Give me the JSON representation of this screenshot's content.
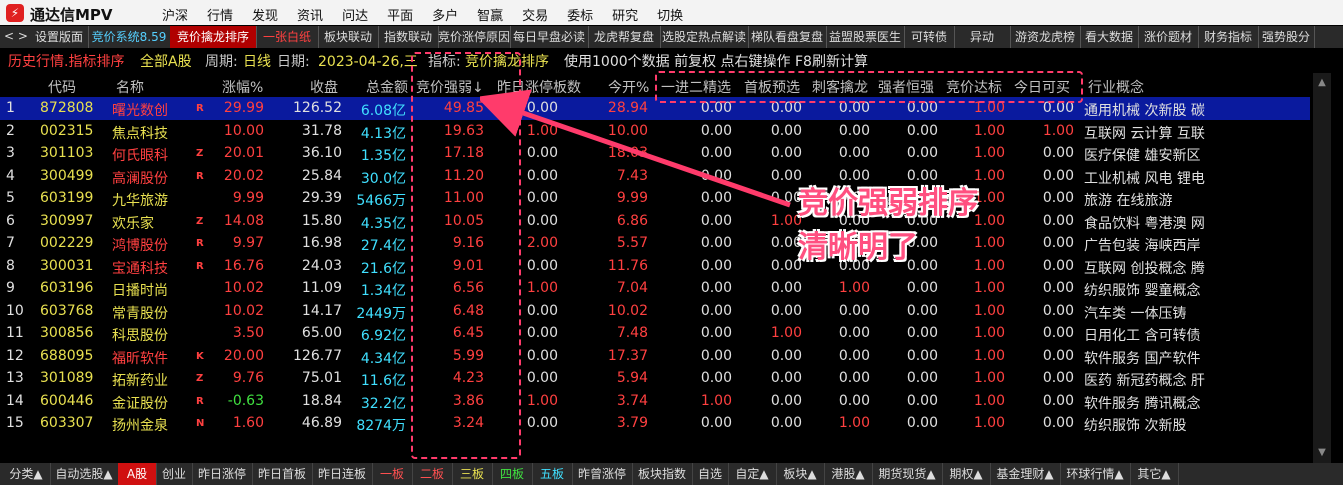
{
  "app": {
    "name": "通达信MPV"
  },
  "menu": [
    "沪深",
    "行情",
    "发现",
    "资讯",
    "问达",
    "平面",
    "多户",
    "智赢",
    "交易",
    "委标",
    "研究",
    "切换"
  ],
  "tabbar": {
    "nav": "< >",
    "tabs": [
      "设置版面",
      "竞价系统8.59",
      "竞价擒龙排序",
      "一张白纸",
      "板块联动",
      "指数联动",
      "竞价涨停原因",
      "每日早盘必读",
      "龙虎帮复盘",
      "选股定热点解读",
      "梯队看盘复盘",
      "益盟股票医生",
      "可转债",
      "异动",
      "游资龙虎榜",
      "看大数据",
      "涨价题材",
      "财务指标",
      "强势股分"
    ]
  },
  "infobar": {
    "mode": "历史行情.指标排序",
    "market": "全部A股",
    "period_label": "周期:",
    "period": "日线",
    "date_label": "日期:",
    "date": "2023-04-26,三",
    "indicator_label": "指标:",
    "indicator": "竞价擒龙排序",
    "note": "使用1000个数据 前复权 点右键操作 F8刷新计算"
  },
  "header": {
    "code": "代码",
    "name": "名称",
    "pct": "涨幅%",
    "close": "收盘",
    "amount": "总金额",
    "strength": "竞价强弱↓",
    "prev_limit": "昨日涨停板数",
    "open_pct": "今开%",
    "f1": "一进二精选",
    "f2": "首板预选",
    "f3": "刺客擒龙",
    "f4": "强者恒强",
    "f5": "竞价达标",
    "f6": "今日可买",
    "concept": "行业概念"
  },
  "rows": [
    {
      "idx": "1",
      "code": "872808",
      "name": "曙光数创",
      "flag": "R",
      "pct": "29.99",
      "close": "126.52",
      "amount": "6.08亿",
      "strength": "49.85",
      "prev": "0.00",
      "open": "28.94",
      "f1": "0.00",
      "f2": "0.00",
      "f3": "0.00",
      "f4": "0.00",
      "f5": "1.00",
      "f6": "0.00",
      "concept": "通用机械  次新股 碳"
    },
    {
      "idx": "2",
      "code": "002315",
      "name": "焦点科技",
      "flag": "",
      "pct": "10.00",
      "close": "31.78",
      "amount": "4.13亿",
      "strength": "19.63",
      "prev": "1.00",
      "open": "10.00",
      "f1": "0.00",
      "f2": "0.00",
      "f3": "0.00",
      "f4": "0.00",
      "f5": "1.00",
      "f6": "1.00",
      "concept": "互联网  云计算 互联"
    },
    {
      "idx": "3",
      "code": "301103",
      "name": "何氏眼科",
      "flag": "Z",
      "pct": "20.01",
      "close": "36.10",
      "amount": "1.35亿",
      "strength": "17.18",
      "prev": "0.00",
      "open": "18.03",
      "f1": "0.00",
      "f2": "0.00",
      "f3": "0.00",
      "f4": "0.00",
      "f5": "1.00",
      "f6": "0.00",
      "concept": "医疗保健  雄安新区"
    },
    {
      "idx": "4",
      "code": "300499",
      "name": "高澜股份",
      "flag": "R",
      "pct": "20.02",
      "close": "25.84",
      "amount": "30.0亿",
      "strength": "11.20",
      "prev": "0.00",
      "open": "7.43",
      "f1": "0.00",
      "f2": "0.00",
      "f3": "0.00",
      "f4": "0.00",
      "f5": "1.00",
      "f6": "0.00",
      "concept": "工业机械  风电 锂电"
    },
    {
      "idx": "5",
      "code": "603199",
      "name": "九华旅游",
      "flag": "",
      "pct": "9.99",
      "close": "29.39",
      "amount": "5466万",
      "strength": "11.00",
      "prev": "0.00",
      "open": "9.99",
      "f1": "0.00",
      "f2": "0.00",
      "f3": "0.00",
      "f4": "0.00",
      "f5": "1.00",
      "f6": "0.00",
      "concept": "旅游  在线旅游"
    },
    {
      "idx": "6",
      "code": "300997",
      "name": "欢乐家",
      "flag": "Z",
      "pct": "14.08",
      "close": "15.80",
      "amount": "4.35亿",
      "strength": "10.05",
      "prev": "0.00",
      "open": "6.86",
      "f1": "0.00",
      "f2": "1.00",
      "f3": "0.00",
      "f4": "0.00",
      "f5": "1.00",
      "f6": "0.00",
      "concept": "食品饮料  粤港澳 网"
    },
    {
      "idx": "7",
      "code": "002229",
      "name": "鸿博股份",
      "flag": "R",
      "pct": "9.97",
      "close": "16.98",
      "amount": "27.4亿",
      "strength": "9.16",
      "prev": "2.00",
      "open": "5.57",
      "f1": "0.00",
      "f2": "0.00",
      "f3": "0.00",
      "f4": "0.00",
      "f5": "1.00",
      "f6": "0.00",
      "concept": "广告包装  海峡西岸"
    },
    {
      "idx": "8",
      "code": "300031",
      "name": "宝通科技",
      "flag": "R",
      "pct": "16.76",
      "close": "24.03",
      "amount": "21.6亿",
      "strength": "9.01",
      "prev": "0.00",
      "open": "11.76",
      "f1": "0.00",
      "f2": "0.00",
      "f3": "0.00",
      "f4": "0.00",
      "f5": "1.00",
      "f6": "0.00",
      "concept": "互联网  创投概念 腾"
    },
    {
      "idx": "9",
      "code": "603196",
      "name": "日播时尚",
      "flag": "",
      "pct": "10.02",
      "close": "11.09",
      "amount": "1.34亿",
      "strength": "6.56",
      "prev": "1.00",
      "open": "7.04",
      "f1": "0.00",
      "f2": "0.00",
      "f3": "1.00",
      "f4": "0.00",
      "f5": "1.00",
      "f6": "0.00",
      "concept": "纺织服饰  婴童概念"
    },
    {
      "idx": "10",
      "code": "603768",
      "name": "常青股份",
      "flag": "",
      "pct": "10.02",
      "close": "14.17",
      "amount": "2449万",
      "strength": "6.48",
      "prev": "0.00",
      "open": "10.02",
      "f1": "0.00",
      "f2": "0.00",
      "f3": "0.00",
      "f4": "0.00",
      "f5": "1.00",
      "f6": "0.00",
      "concept": "汽车类  一体压铸"
    },
    {
      "idx": "11",
      "code": "300856",
      "name": "科思股份",
      "flag": "",
      "pct": "3.50",
      "close": "65.00",
      "amount": "6.92亿",
      "strength": "6.45",
      "prev": "0.00",
      "open": "7.48",
      "f1": "0.00",
      "f2": "1.00",
      "f3": "0.00",
      "f4": "0.00",
      "f5": "1.00",
      "f6": "0.00",
      "concept": "日用化工  含可转债"
    },
    {
      "idx": "12",
      "code": "688095",
      "name": "福昕软件",
      "flag": "K",
      "pct": "20.00",
      "close": "126.77",
      "amount": "4.34亿",
      "strength": "5.99",
      "prev": "0.00",
      "open": "17.37",
      "f1": "0.00",
      "f2": "0.00",
      "f3": "0.00",
      "f4": "0.00",
      "f5": "1.00",
      "f6": "0.00",
      "concept": "软件服务  国产软件"
    },
    {
      "idx": "13",
      "code": "301089",
      "name": "拓新药业",
      "flag": "Z",
      "pct": "9.76",
      "close": "75.01",
      "amount": "11.6亿",
      "strength": "4.23",
      "prev": "0.00",
      "open": "5.94",
      "f1": "0.00",
      "f2": "0.00",
      "f3": "0.00",
      "f4": "0.00",
      "f5": "1.00",
      "f6": "0.00",
      "concept": "医药  新冠药概念 肝"
    },
    {
      "idx": "14",
      "code": "600446",
      "name": "金证股份",
      "flag": "R",
      "pct": "-0.63",
      "close": "18.84",
      "amount": "32.2亿",
      "strength": "3.86",
      "prev": "1.00",
      "open": "3.74",
      "f1": "1.00",
      "f2": "0.00",
      "f3": "0.00",
      "f4": "0.00",
      "f5": "1.00",
      "f6": "0.00",
      "concept": "软件服务  腾讯概念"
    },
    {
      "idx": "15",
      "code": "603307",
      "name": "扬州金泉",
      "flag": "N",
      "pct": "1.60",
      "close": "46.89",
      "amount": "8274万",
      "strength": "3.24",
      "prev": "0.00",
      "open": "3.79",
      "f1": "0.00",
      "f2": "0.00",
      "f3": "1.00",
      "f4": "0.00",
      "f5": "1.00",
      "f6": "0.00",
      "concept": "纺织服饰  次新股"
    }
  ],
  "bottombar": [
    "分类▲",
    "自动选股▲",
    "A股",
    "创业",
    "昨日涨停",
    "昨日首板",
    "昨日连板",
    "一板",
    "二板",
    "三板",
    "四板",
    "五板",
    "昨曾涨停",
    "板块指数",
    "自选",
    "自定▲",
    "板块▲",
    "港股▲",
    "期货现货▲",
    "期权▲",
    "基金理财▲",
    "环球行情▲",
    "其它▲"
  ],
  "annotation": {
    "line1": "竞价强弱排序",
    "line2": "清晰明了"
  },
  "colors": {
    "annotation": "#ff5080",
    "selected_row": "#0a1a9e",
    "active_tab": "#d01010"
  }
}
